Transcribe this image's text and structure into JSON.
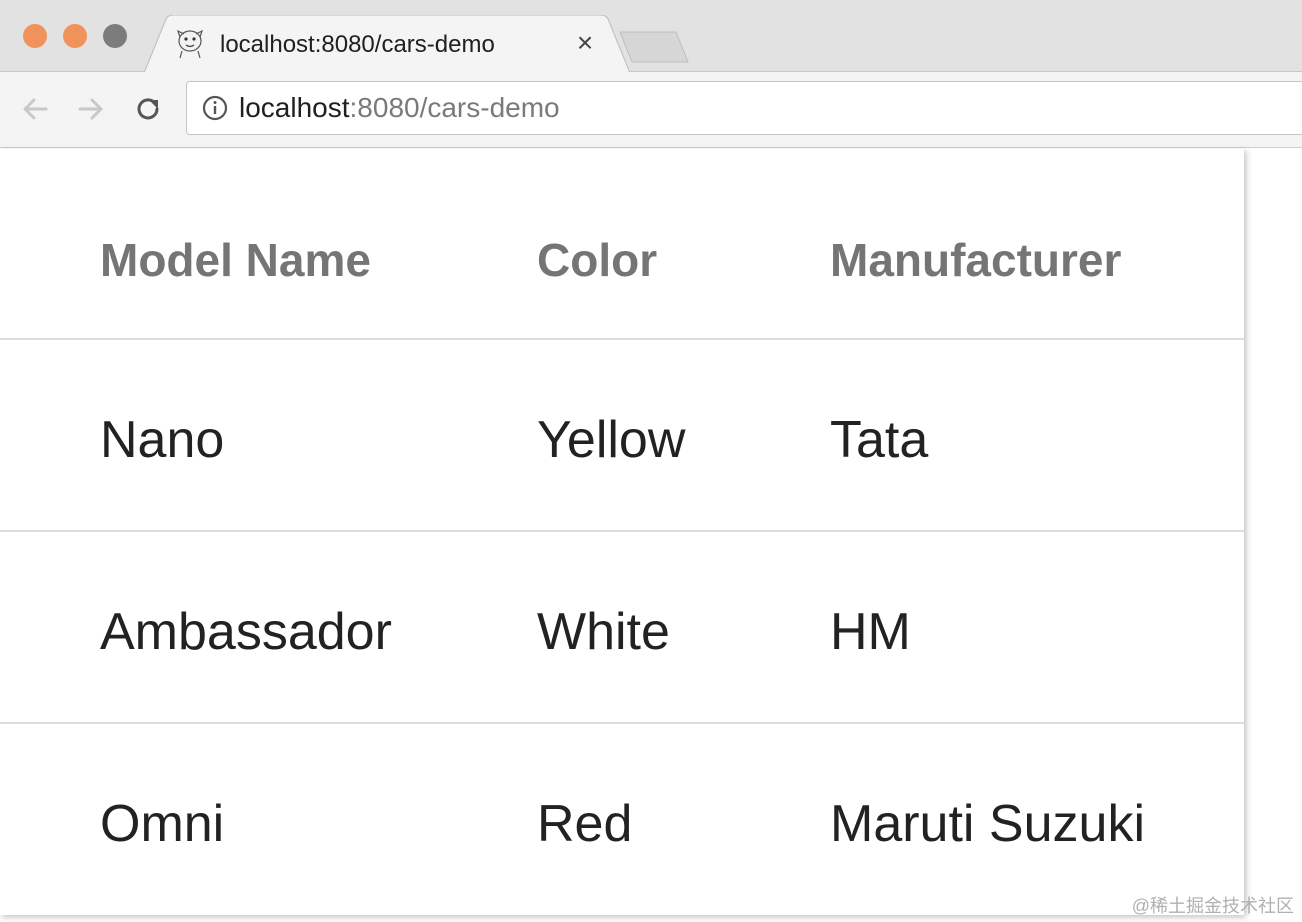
{
  "browser": {
    "tab": {
      "title": "localhost:8080/cars-demo",
      "close_glyph": "×",
      "favicon": "character-favicon-icon"
    },
    "address_bar": {
      "host": "localhost",
      "rest": ":8080/cars-demo"
    },
    "icons": {
      "back": "arrow-left-icon",
      "forward": "arrow-right-icon",
      "reload": "reload-icon",
      "info": "info-icon"
    },
    "colors": {
      "traffic_close": "#f0935b",
      "traffic_minimize": "#f0935b",
      "traffic_maximize": "#7c7c7c"
    }
  },
  "table": {
    "headers": {
      "model": "Model Name",
      "color": "Color",
      "manufacturer": "Manufacturer"
    },
    "rows": [
      {
        "model": "Nano",
        "color": "Yellow",
        "manufacturer": "Tata"
      },
      {
        "model": "Ambassador",
        "color": "White",
        "manufacturer": "HM"
      },
      {
        "model": "Omni",
        "color": "Red",
        "manufacturer": "Maruti Suzuki"
      }
    ]
  },
  "watermark": "@稀土掘金技术社区"
}
